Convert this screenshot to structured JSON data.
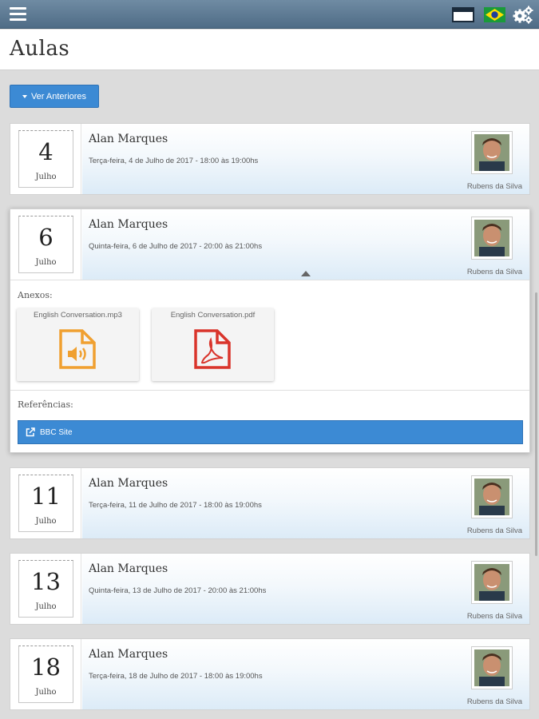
{
  "page": {
    "title": "Aulas"
  },
  "toolbar": {
    "prev_button": "Ver Anteriores"
  },
  "lessons": [
    {
      "day": "4",
      "month": "Julho",
      "teacher": "Alan Marques",
      "when": "Terça-feira, 4 de Julho de 2017 - 18:00 às 19:00hs",
      "student": "Rubens da Silva"
    },
    {
      "day": "6",
      "month": "Julho",
      "teacher": "Alan Marques",
      "when": "Quinta-feira, 6 de Julho de 2017 - 20:00 às 21:00hs",
      "student": "Rubens da Silva"
    },
    {
      "day": "11",
      "month": "Julho",
      "teacher": "Alan Marques",
      "when": "Terça-feira, 11 de Julho de 2017 - 18:00 às 19:00hs",
      "student": "Rubens da Silva"
    },
    {
      "day": "13",
      "month": "Julho",
      "teacher": "Alan Marques",
      "when": "Quinta-feira, 13 de Julho de 2017 - 20:00 às 21:00hs",
      "student": "Rubens da Silva"
    },
    {
      "day": "18",
      "month": "Julho",
      "teacher": "Alan Marques",
      "when": "Terça-feira, 18 de Julho de 2017 - 18:00 às 19:00hs",
      "student": "Rubens da Silva"
    }
  ],
  "expanded": {
    "attachments_label": "Anexos:",
    "attachments": [
      {
        "name": "English Conversation.mp3",
        "icon": "audio-file-icon",
        "color": "#f0a030"
      },
      {
        "name": "English Conversation.pdf",
        "icon": "pdf-file-icon",
        "color": "#d9342b"
      }
    ],
    "references_label": "Referências:",
    "reference_link": "BBC Site"
  },
  "colors": {
    "accent": "#3c8ad4",
    "topbar": "#5a7891"
  }
}
